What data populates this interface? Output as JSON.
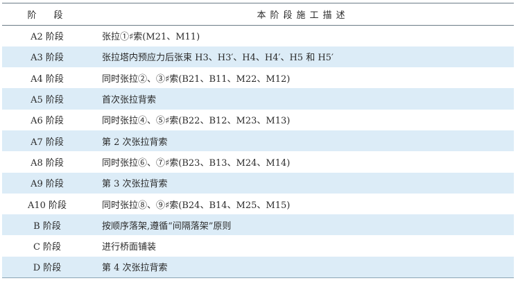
{
  "table": {
    "headers": [
      "阶　段",
      "本阶段施工描述"
    ],
    "rows": [
      {
        "stage": "A2 阶段",
        "desc": "张拉①♯索(M21、M11)"
      },
      {
        "stage": "A3 阶段",
        "desc": "张拉塔内预应力后张束 H3、H3′、H4、H4′、H5 和 H5′"
      },
      {
        "stage": "A4 阶段",
        "desc": "同时张拉②、③♯索(B21、B11、M22、M12)"
      },
      {
        "stage": "A5 阶段",
        "desc": "首次张拉背索"
      },
      {
        "stage": "A6 阶段",
        "desc": "同时张拉④、⑤♯索(B22、B12、M23、M13)"
      },
      {
        "stage": "A7 阶段",
        "desc": "第 2 次张拉背索"
      },
      {
        "stage": "A8 阶段",
        "desc": "同时张拉⑥、⑦♯索(B23、B13、M24、M14)"
      },
      {
        "stage": "A9 阶段",
        "desc": "第 3 次张拉背索"
      },
      {
        "stage": "A10 阶段",
        "desc": "同时张拉⑧、⑨♯索(B24、B14、M25、M15)"
      },
      {
        "stage": "B 阶段",
        "desc": "按顺序落架,遵循“间隔落架”原则"
      },
      {
        "stage": "C 阶段",
        "desc": "进行桥面铺装"
      },
      {
        "stage": "D 阶段",
        "desc": "第 4 次张拉背索"
      }
    ]
  }
}
